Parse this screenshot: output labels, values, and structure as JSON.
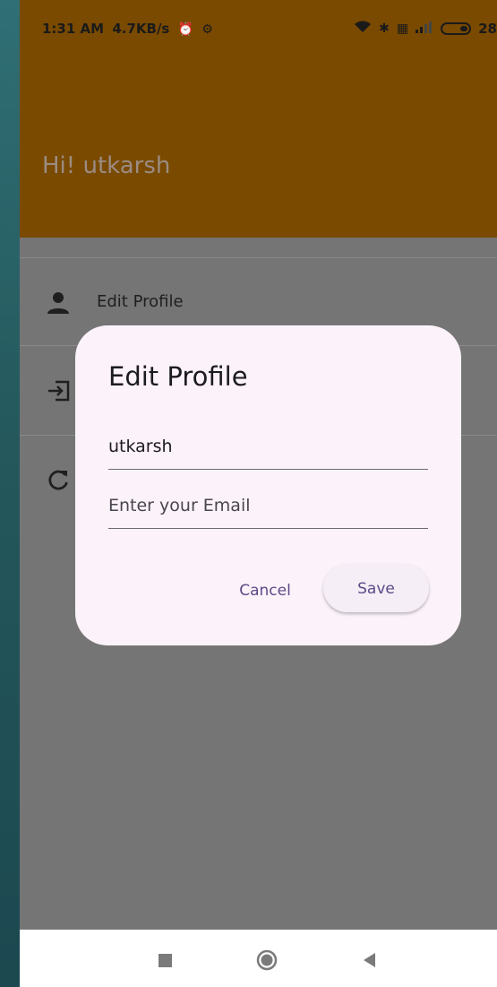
{
  "status_bar": {
    "time": "1:31 AM",
    "speed": "4.7KB/s",
    "battery": "28"
  },
  "header": {
    "greeting": "Hi! utkarsh"
  },
  "menu": {
    "items": [
      {
        "label": "Edit Profile",
        "icon": "person-icon"
      },
      {
        "label": "",
        "icon": "logout-icon"
      },
      {
        "label": "",
        "icon": "refresh-icon"
      }
    ]
  },
  "dialog": {
    "title": "Edit Profile",
    "name_value": "utkarsh",
    "email_placeholder": "Enter your Email",
    "cancel_label": "Cancel",
    "save_label": "Save"
  },
  "colors": {
    "header_dim": "#7a4a00",
    "scrim": "#757575",
    "dialog_bg": "#fcf2fa",
    "button_text": "#5a4a86"
  }
}
